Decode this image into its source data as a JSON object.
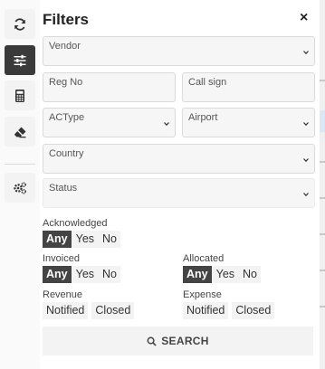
{
  "panel": {
    "title": "Filters",
    "close_glyph": "×"
  },
  "toolbar": {
    "items": [
      {
        "icon": "refresh-icon",
        "active": false
      },
      {
        "icon": "sliders-icon",
        "active": true
      },
      {
        "icon": "calculator-icon",
        "active": false
      },
      {
        "icon": "eraser-icon",
        "active": false
      },
      {
        "icon": "cogs-icon",
        "active": false
      }
    ]
  },
  "fields": {
    "vendor": {
      "label": "Vendor"
    },
    "reg_no": {
      "label": "Reg No"
    },
    "call_sign": {
      "label": "Call sign"
    },
    "actype": {
      "label": "ACType"
    },
    "airport": {
      "label": "Airport"
    },
    "country": {
      "label": "Country"
    },
    "status": {
      "label": "Status"
    }
  },
  "toggles": {
    "acknowledged": {
      "label": "Acknowledged",
      "options": [
        "Any",
        "Yes",
        "No"
      ],
      "selected": "Any"
    },
    "invoiced": {
      "label": "Invoiced",
      "options": [
        "Any",
        "Yes",
        "No"
      ],
      "selected": "Any"
    },
    "allocated": {
      "label": "Allocated",
      "options": [
        "Any",
        "Yes",
        "No"
      ],
      "selected": "Any"
    },
    "revenue": {
      "label": "Revenue",
      "options": [
        "Notified",
        "Closed"
      ],
      "selected": ""
    },
    "expense": {
      "label": "Expense",
      "options": [
        "Notified",
        "Closed"
      ],
      "selected": ""
    }
  },
  "search_button": {
    "label": "SEARCH",
    "icon": "search-icon"
  },
  "colors": {
    "active_bg": "#444444",
    "control_bg": "#f3f3f3",
    "field_border": "#dadada"
  }
}
